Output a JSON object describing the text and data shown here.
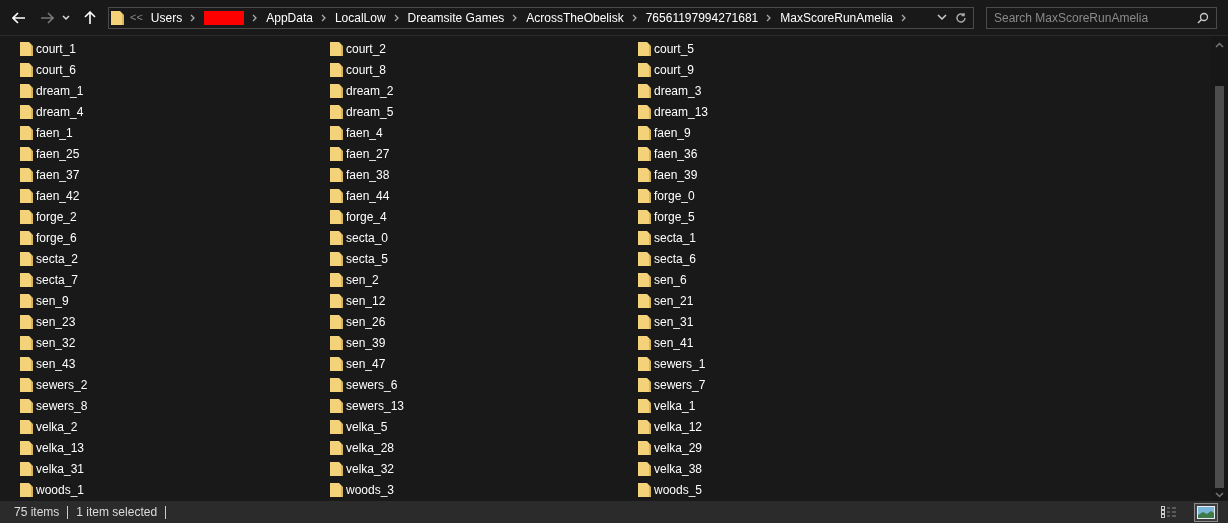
{
  "address_bar": {
    "overflow": "<<",
    "segments": [
      {
        "kind": "text",
        "label": "Users"
      },
      {
        "kind": "redacted"
      },
      {
        "kind": "text",
        "label": "AppData"
      },
      {
        "kind": "text",
        "label": "LocalLow"
      },
      {
        "kind": "text",
        "label": "Dreamsite Games"
      },
      {
        "kind": "text",
        "label": "AcrossTheObelisk"
      },
      {
        "kind": "text",
        "label": "76561197994271681"
      },
      {
        "kind": "text",
        "label": "MaxScoreRunAmelia"
      }
    ]
  },
  "search": {
    "placeholder": "Search MaxScoreRunAmelia"
  },
  "items": [
    "court_1",
    "court_2",
    "court_5",
    "court_6",
    "court_8",
    "court_9",
    "dream_1",
    "dream_2",
    "dream_3",
    "dream_4",
    "dream_5",
    "dream_13",
    "faen_1",
    "faen_4",
    "faen_9",
    "faen_25",
    "faen_27",
    "faen_36",
    "faen_37",
    "faen_38",
    "faen_39",
    "faen_42",
    "faen_44",
    "forge_0",
    "forge_2",
    "forge_4",
    "forge_5",
    "forge_6",
    "secta_0",
    "secta_1",
    "secta_2",
    "secta_5",
    "secta_6",
    "secta_7",
    "sen_2",
    "sen_6",
    "sen_9",
    "sen_12",
    "sen_21",
    "sen_23",
    "sen_26",
    "sen_31",
    "sen_32",
    "sen_39",
    "sen_41",
    "sen_43",
    "sen_47",
    "sewers_1",
    "sewers_2",
    "sewers_6",
    "sewers_7",
    "sewers_8",
    "sewers_13",
    "velka_1",
    "velka_2",
    "velka_5",
    "velka_12",
    "velka_13",
    "velka_28",
    "velka_29",
    "velka_31",
    "velka_32",
    "velka_38",
    "woods_1",
    "woods_3",
    "woods_5"
  ],
  "status_bar": {
    "item_count": "75 items",
    "selection": "1 item selected"
  },
  "view_buttons": [
    {
      "kind": "details",
      "selected": false
    },
    {
      "kind": "large_icons",
      "selected": true
    }
  ]
}
